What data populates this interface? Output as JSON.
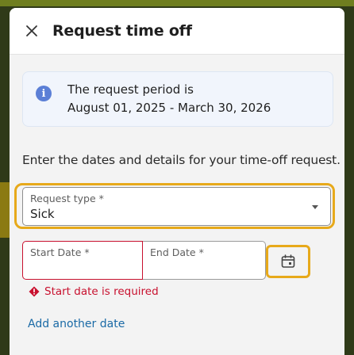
{
  "dialog": {
    "title": "Request time off"
  },
  "info": {
    "line1": "The request period is",
    "line2": "August 01, 2025 - March 30, 2026"
  },
  "instructions": "Enter the dates and details for your time-off request.",
  "request_type": {
    "label": "Request type *",
    "value": "Sick"
  },
  "dates": {
    "start_label": "Start Date *",
    "start_value": "",
    "end_label": "End Date *",
    "end_value": ""
  },
  "error": {
    "message": "Start date is required"
  },
  "add_date_link": "Add another date",
  "colors": {
    "focus": "#e7a91a",
    "error": "#c8102e",
    "link": "#1a6aa6",
    "info_icon": "#5b7fd6"
  },
  "icons": {
    "close": "close-icon",
    "info": "info-icon",
    "dropdown": "chevron-down-icon",
    "calendar": "calendar-icon",
    "error": "error-diamond-icon"
  }
}
